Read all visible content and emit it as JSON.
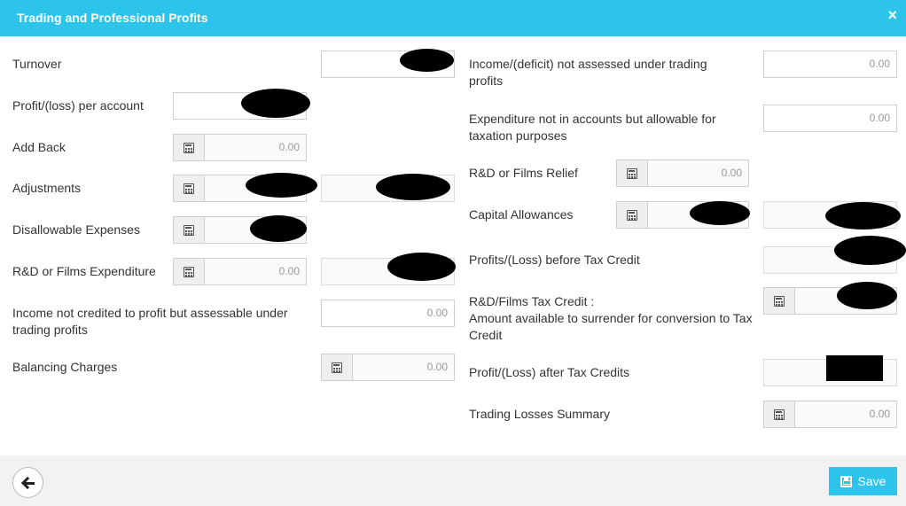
{
  "dialog": {
    "title": "Trading and Professional Profits",
    "close_icon": "×"
  },
  "left": {
    "turnover": {
      "label": "Turnover"
    },
    "profit_loss_per_account": {
      "label": "Profit/(loss) per account"
    },
    "add_back": {
      "label": "Add Back",
      "value": "0.00"
    },
    "adjustments": {
      "label": "Adjustments"
    },
    "disallowable_expenses": {
      "label": "Disallowable Expenses"
    },
    "rd_films_expenditure": {
      "label": "R&D or Films Expenditure",
      "value": "0.00"
    },
    "income_not_credited": {
      "label": "Income not credited to profit but assessable under trading profits",
      "value": "0.00"
    },
    "balancing_charges": {
      "label": "Balancing Charges",
      "value": "0.00"
    }
  },
  "right": {
    "income_deficit": {
      "label": "Income/(deficit) not assessed under trading profits",
      "value": "0.00"
    },
    "expenditure_not_in_accounts": {
      "label": "Expenditure not in accounts but allowable for taxation purposes",
      "value": "0.00"
    },
    "rd_films_relief": {
      "label": "R&D or Films Relief",
      "value": "0.00"
    },
    "capital_allowances": {
      "label": "Capital Allowances"
    },
    "profits_before_tax_credit": {
      "label": "Profits/(Loss) before Tax Credit"
    },
    "rd_films_tax_credit": {
      "label_line1": "R&D/Films Tax Credit :",
      "label_line2": "Amount available to surrender for conversion to Tax Credit"
    },
    "profit_after_tax_credits": {
      "label": "Profit/(Loss) after Tax Credits"
    },
    "trading_losses_summary": {
      "label": "Trading Losses Summary",
      "value": "0.00"
    }
  },
  "footer": {
    "save_label": "Save"
  },
  "colors": {
    "accent": "#2cc4ea",
    "footer_bg": "#f2f2f2"
  }
}
